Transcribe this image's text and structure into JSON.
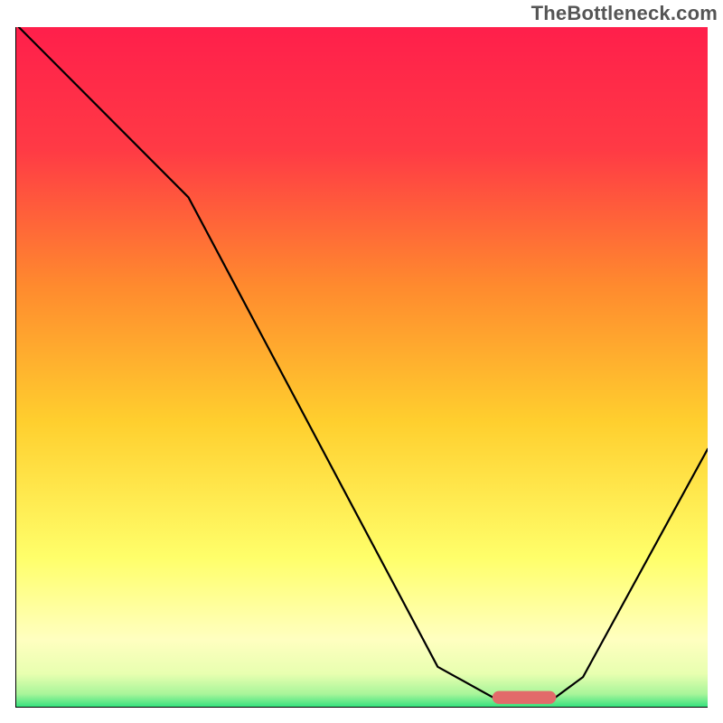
{
  "watermark": "TheBottleneck.com",
  "chart_data": {
    "type": "line",
    "title": "",
    "xlabel": "",
    "ylabel": "",
    "xlim": [
      0,
      100
    ],
    "ylim": [
      0,
      100
    ],
    "grid": false,
    "legend": false,
    "gradient_colors": {
      "top": "#ff1f4b",
      "upper_mid": "#ff6a2e",
      "mid": "#ffcf2e",
      "lower_mid": "#ffff8a",
      "near_bottom": "#e8ffb0",
      "bottom": "#2fe07c"
    },
    "series": [
      {
        "name": "bottleneck-curve",
        "x": [
          0.5,
          25,
          61,
          69,
          78,
          82,
          100
        ],
        "values": [
          100,
          75,
          6,
          1.5,
          1.5,
          4.5,
          38
        ]
      }
    ],
    "marker": {
      "name": "optimal-range",
      "shape": "rounded-bar",
      "color": "#e26a6a",
      "x_center": 73.5,
      "y": 1.5,
      "width": 9.2,
      "height": 1.9
    }
  }
}
